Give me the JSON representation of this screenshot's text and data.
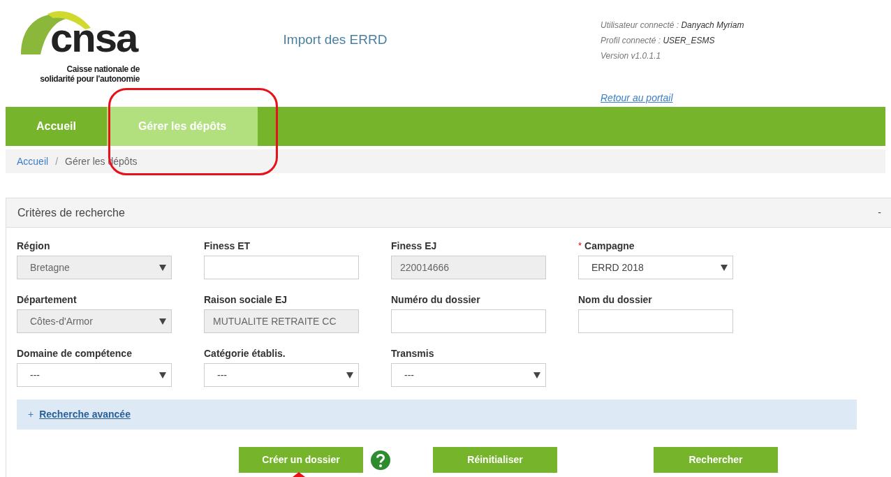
{
  "logo": {
    "wordmark": "cnsa",
    "subtitle_line_1": "Caisse nationale de",
    "subtitle_line_2": "solidarité pour l'autonomie"
  },
  "app_title": "Import des ERRD",
  "user_info": [
    {
      "label": "Utilisateur connecté : ",
      "value": "Danyach Myriam"
    },
    {
      "label": "Profil connecté : ",
      "value": "USER_ESMS"
    },
    {
      "label": "Version v1.0.1.1"
    }
  ],
  "portal_link": "Retour au portail",
  "nav": [
    {
      "label": "Accueil",
      "selected": false
    },
    {
      "label": "Gérer les dépôts",
      "selected": true
    }
  ],
  "breadcrumb": [
    {
      "label": "Accueil",
      "link": true
    },
    {
      "label": "Gérer les dépôts",
      "link": false
    }
  ],
  "breadcrumb_separator": "/",
  "panel": {
    "title": "Critères de recherche",
    "collapse": "-",
    "required_mark": "*",
    "fields": [
      {
        "label": "Région",
        "kind": "select",
        "value": "Bretagne",
        "disabled": true,
        "required": false
      },
      {
        "label": "Finess ET",
        "kind": "text",
        "disabled": false,
        "required": false
      },
      {
        "label": "Finess EJ",
        "kind": "text",
        "value": "220014666",
        "disabled": true,
        "required": false
      },
      {
        "label": "Campagne",
        "kind": "select",
        "value": "ERRD 2018",
        "disabled": false,
        "required": true
      },
      {
        "label": "Département",
        "kind": "select",
        "value": "Côtes-d'Armor",
        "disabled": true,
        "required": false
      },
      {
        "label": "Raison sociale EJ",
        "kind": "text",
        "value": "MUTUALITE RETRAITE CC",
        "disabled": true,
        "required": false
      },
      {
        "label": "Numéro du dossier",
        "kind": "text",
        "disabled": false,
        "required": false
      },
      {
        "label": "Nom du dossier",
        "kind": "text",
        "disabled": false,
        "required": false
      },
      {
        "label": "Domaine de compétence",
        "kind": "select",
        "value": "---",
        "disabled": false,
        "required": false
      },
      {
        "label": "Catégorie établis.",
        "kind": "select",
        "value": "---",
        "disabled": false,
        "required": false
      },
      {
        "label": "Transmis",
        "kind": "select",
        "value": "---",
        "disabled": false,
        "required": false
      }
    ],
    "advanced": {
      "toggle": "+",
      "label": "Recherche avancée"
    },
    "buttons": [
      {
        "label": "Créer un dossier",
        "help": true
      },
      {
        "label": "Réinitialiser",
        "help": false
      },
      {
        "label": "Rechercher",
        "help": false
      }
    ]
  }
}
